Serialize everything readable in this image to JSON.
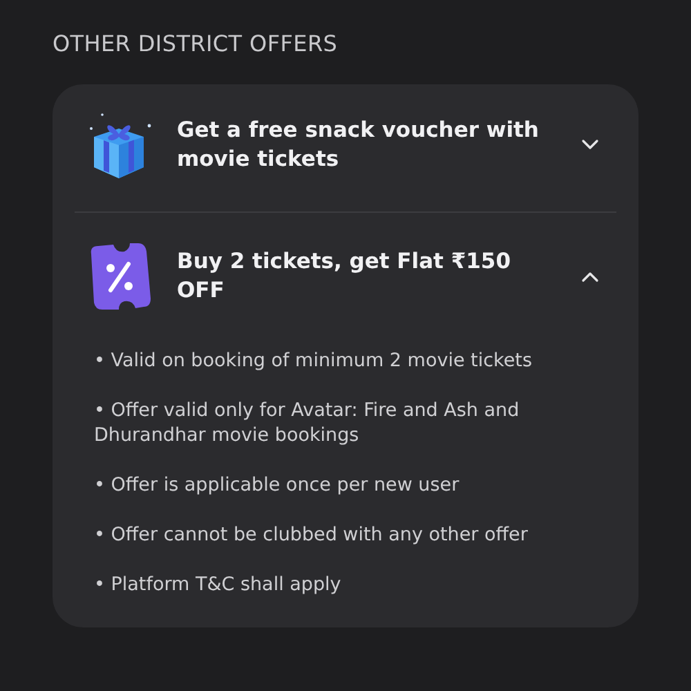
{
  "section_title": "OTHER DISTRICT OFFERS",
  "offers": [
    {
      "kind": "gift",
      "title": "Get a free snack voucher with movie tickets",
      "expanded": false
    },
    {
      "kind": "ticket",
      "title": "Buy 2 tickets, get Flat ₹150 OFF",
      "expanded": true,
      "terms": [
        "• Valid on booking of minimum 2 movie tickets",
        "• Offer valid only for Avatar: Fire and Ash and Dhurandhar movie bookings",
        "• Offer is applicable once per new user",
        "• Offer cannot be clubbed with any other offer",
        "• Platform T&C shall apply"
      ]
    }
  ]
}
